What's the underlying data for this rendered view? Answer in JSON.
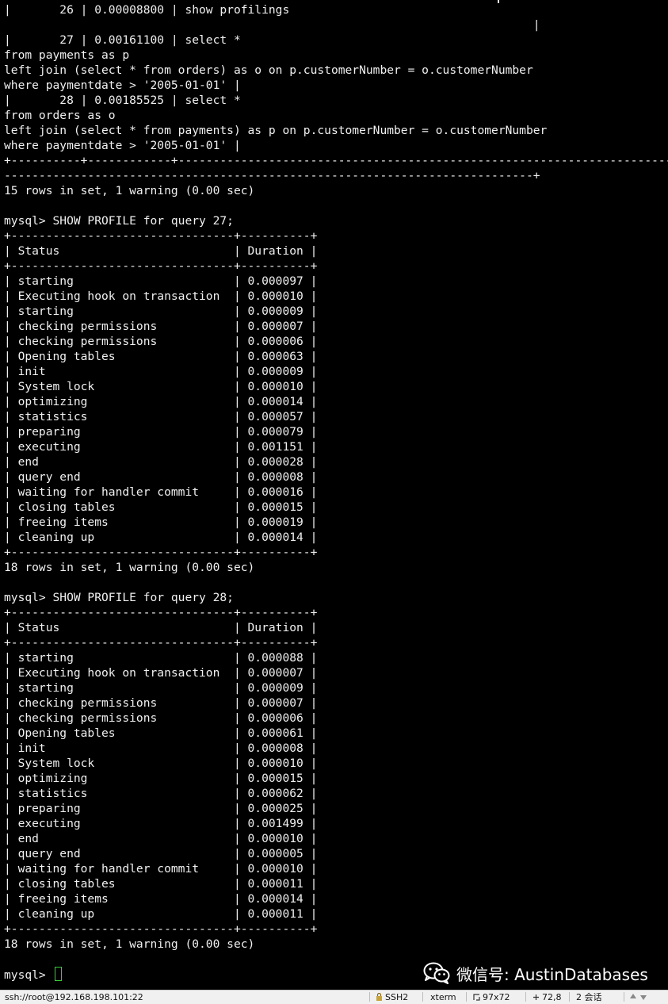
{
  "terminal": {
    "lines": [
      "|       26 | 0.00008800 | show profilings",
      "                                                                            |",
      "|       27 | 0.00161100 | select *",
      "from payments as p",
      "left join (select * from orders) as o on p.customerNumber = o.customerNumber",
      "where paymentdate > '2005-01-01' |",
      "|       28 | 0.00185525 | select *",
      "from orders as o",
      "left join (select * from payments) as p on p.customerNumber = o.customerNumber",
      "where paymentdate > '2005-01-01' |",
      "+----------+------------+-------------------------------------------------------------------------",
      "----------------------------------------------------------------------------+",
      "15 rows in set, 1 warning (0.00 sec)",
      "",
      "mysql> SHOW PROFILE for query 27;",
      "+--------------------------------+----------+",
      "| Status                         | Duration |",
      "+--------------------------------+----------+",
      "| starting                       | 0.000097 |",
      "| Executing hook on transaction  | 0.000010 |",
      "| starting                       | 0.000009 |",
      "| checking permissions           | 0.000007 |",
      "| checking permissions           | 0.000006 |",
      "| Opening tables                 | 0.000063 |",
      "| init                           | 0.000009 |",
      "| System lock                    | 0.000010 |",
      "| optimizing                     | 0.000014 |",
      "| statistics                     | 0.000057 |",
      "| preparing                      | 0.000079 |",
      "| executing                      | 0.001151 |",
      "| end                            | 0.000028 |",
      "| query end                      | 0.000008 |",
      "| waiting for handler commit     | 0.000016 |",
      "| closing tables                 | 0.000015 |",
      "| freeing items                  | 0.000019 |",
      "| cleaning up                    | 0.000014 |",
      "+--------------------------------+----------+",
      "18 rows in set, 1 warning (0.00 sec)",
      "",
      "mysql> SHOW PROFILE for query 28;",
      "+--------------------------------+----------+",
      "| Status                         | Duration |",
      "+--------------------------------+----------+",
      "| starting                       | 0.000088 |",
      "| Executing hook on transaction  | 0.000007 |",
      "| starting                       | 0.000009 |",
      "| checking permissions           | 0.000007 |",
      "| checking permissions           | 0.000006 |",
      "| Opening tables                 | 0.000061 |",
      "| init                           | 0.000008 |",
      "| System lock                    | 0.000010 |",
      "| optimizing                     | 0.000015 |",
      "| statistics                     | 0.000062 |",
      "| preparing                      | 0.000025 |",
      "| executing                      | 0.001499 |",
      "| end                            | 0.000010 |",
      "| query end                      | 0.000005 |",
      "| waiting for handler commit     | 0.000010 |",
      "| closing tables                 | 0.000011 |",
      "| freeing items                  | 0.000014 |",
      "| cleaning up                    | 0.000011 |",
      "+--------------------------------+----------+",
      "18 rows in set, 1 warning (0.00 sec)",
      ""
    ],
    "prompt": "mysql> "
  },
  "watermark": {
    "text": "微信号: AustinDatabases",
    "icon": "wechat-icon"
  },
  "status_bar": {
    "connection": "ssh://root@192.168.198.101:22",
    "protocol": "SSH2",
    "terminal_type": "xterm",
    "size": "97x72",
    "cursor_position": "72,8",
    "sessions": "2 会话"
  },
  "colors": {
    "background": "#000000",
    "text": "#f0f0f0",
    "cursor": "#34d134",
    "status_bar": "#f0f0f0"
  }
}
